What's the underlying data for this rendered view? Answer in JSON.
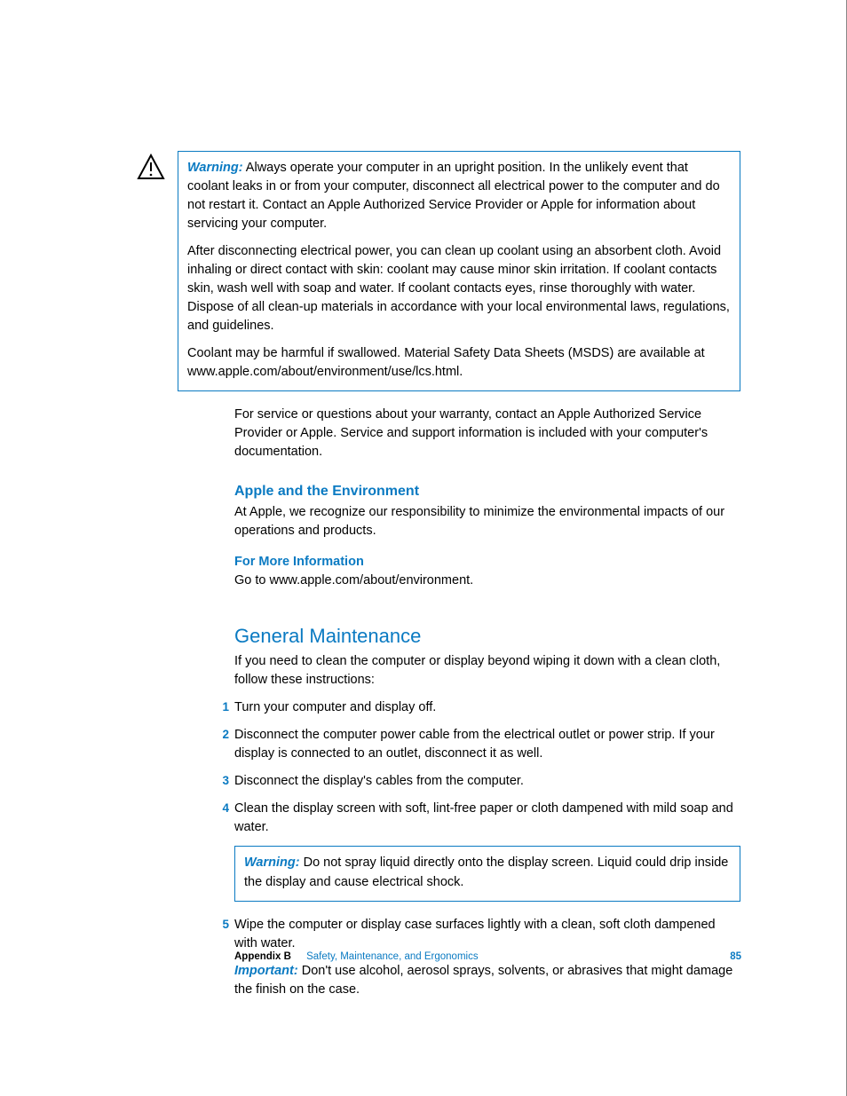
{
  "warning1": {
    "label": "Warning:",
    "p1": "Always operate your computer in an upright position. In the unlikely event that coolant leaks in or from your computer, disconnect all electrical power to the computer and do not restart it. Contact an Apple Authorized Service Provider or Apple for information about servicing your computer.",
    "p2": "After disconnecting electrical power, you can clean up coolant using an absorbent cloth. Avoid inhaling or direct contact with skin:  coolant may cause minor skin irritation. If coolant contacts skin, wash well with soap and water. If coolant contacts eyes, rinse thoroughly with water. Dispose of all clean-up materials in accordance with your local environmental laws, regulations, and guidelines.",
    "p3": "Coolant may be harmful if swallowed. Material Safety Data Sheets (MSDS) are available at www.apple.com/about/environment/use/lcs.html."
  },
  "service_para": "For service or questions about your warranty, contact an Apple Authorized Service Provider or Apple. Service and support information is included with your computer's documentation.",
  "env": {
    "heading": "Apple and the Environment",
    "body": "At Apple, we recognize our responsibility to minimize the environmental impacts of our operations and products.",
    "more_heading": "For More Information",
    "more_body": "Go to www.apple.com/about/environment."
  },
  "maintenance": {
    "title": "General Maintenance",
    "intro": "If you need to clean the computer or display beyond wiping it down with a clean cloth, follow these instructions:",
    "steps": {
      "s1": "Turn your computer and display off.",
      "s2": "Disconnect the computer power cable from the electrical outlet or power strip. If your display is connected to an outlet, disconnect it as well.",
      "s3": "Disconnect the display's cables from the computer.",
      "s4": "Clean the display screen with soft, lint-free paper or cloth dampened with mild soap and water.",
      "s5": "Wipe the computer or display case surfaces lightly with a clean, soft cloth dampened with water."
    },
    "warning2": {
      "label": "Warning:",
      "body": "Do not spray liquid directly onto the display screen. Liquid could drip inside the display and cause electrical shock."
    },
    "important": {
      "label": "Important:",
      "body": "Don't use alcohol, aerosol sprays, solvents, or abrasives that might damage the finish on the case."
    }
  },
  "footer": {
    "appendix": "Appendix B",
    "chapter": "Safety, Maintenance, and Ergonomics",
    "page": "85"
  },
  "nums": {
    "n1": "1",
    "n2": "2",
    "n3": "3",
    "n4": "4",
    "n5": "5"
  }
}
